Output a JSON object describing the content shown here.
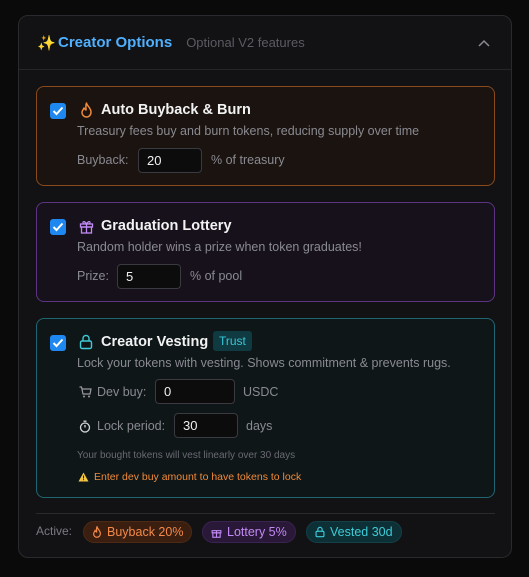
{
  "header": {
    "title": "Creator Options",
    "subtitle": "Optional V2 features"
  },
  "buyback": {
    "title": "Auto Buyback & Burn",
    "description": "Treasury fees buy and burn tokens, reducing supply over time",
    "field_label": "Buyback:",
    "field_value": "20",
    "unit": "% of treasury",
    "checked": true
  },
  "lottery": {
    "title": "Graduation Lottery",
    "description": "Random holder wins a prize when token graduates!",
    "field_label": "Prize:",
    "field_value": "5",
    "unit": "% of pool",
    "checked": true
  },
  "vesting": {
    "title": "Creator Vesting",
    "badge": "Trust",
    "description": "Lock your tokens with vesting. Shows commitment & prevents rugs.",
    "dev_buy_label": "Dev buy:",
    "dev_buy_value": "0",
    "dev_buy_unit": "USDC",
    "lock_label": "Lock period:",
    "lock_value": "30",
    "lock_unit": "days",
    "note": "Your bought tokens will vest linearly over 30 days",
    "warning": "Enter dev buy amount to have tokens to lock",
    "checked": true
  },
  "active": {
    "label": "Active:",
    "chips": [
      "Buyback 20%",
      "Lottery 5%",
      "Vested 30d"
    ]
  },
  "colors": {
    "accent": "#4fb0ff",
    "orange": "#f5894a",
    "purple": "#c28af5",
    "cyan": "#3fcbd8",
    "checkbox": "#1e88f0"
  }
}
